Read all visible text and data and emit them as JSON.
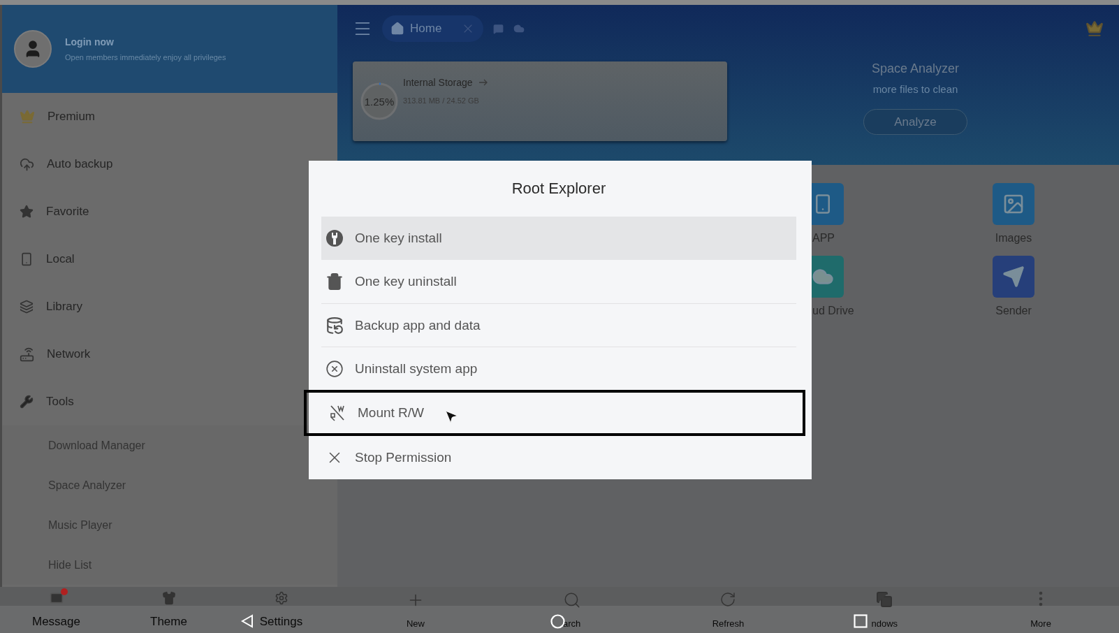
{
  "drawer": {
    "header": {
      "title": "Login now",
      "subtitle": "Open members immediately enjoy all privileges"
    },
    "items": [
      {
        "label": "Premium"
      },
      {
        "label": "Auto backup"
      },
      {
        "label": "Favorite"
      },
      {
        "label": "Local"
      },
      {
        "label": "Library"
      },
      {
        "label": "Network"
      },
      {
        "label": "Tools",
        "expanded": true,
        "children": [
          {
            "label": "Download Manager"
          },
          {
            "label": "Space Analyzer"
          },
          {
            "label": "Music Player"
          },
          {
            "label": "Hide List"
          }
        ]
      }
    ],
    "bottom_tabs": [
      {
        "label": "Message",
        "unread": true
      },
      {
        "label": "Theme",
        "unread": false
      },
      {
        "label": "Settings",
        "unread": false
      }
    ]
  },
  "top_bar": {
    "tab": {
      "label": "Home"
    }
  },
  "storage": {
    "title": "Internal Storage",
    "percent": "1.25%",
    "level": 0.0125,
    "usage": "313.81 MB / 24.52 GB"
  },
  "space_analyzer": {
    "title": "Space Analyzer",
    "subtitle": "more files to clean",
    "button": "Analyze"
  },
  "categories": [
    {
      "label": "APP",
      "color": "#1e5a86"
    },
    {
      "label": "Images",
      "color": "#1e5a86"
    },
    {
      "label": "ud Drive",
      "color": "#1f6b6b"
    },
    {
      "label": "Sender",
      "color": "#263f7a"
    }
  ],
  "toolbar": [
    {
      "label": "New"
    },
    {
      "label": "arch"
    },
    {
      "label": "Refresh"
    },
    {
      "label": "ndows"
    },
    {
      "label": "More"
    }
  ],
  "dialog": {
    "title": "Root Explorer",
    "items": [
      {
        "label": "One key install",
        "selected": true,
        "focused": false
      },
      {
        "label": "One key uninstall",
        "selected": false,
        "focused": false
      },
      {
        "label": "Backup app and data",
        "selected": false,
        "focused": false
      },
      {
        "label": "Uninstall system app",
        "selected": false,
        "focused": false
      },
      {
        "label": "Mount R/W",
        "selected": false,
        "focused": true
      },
      {
        "label": "Stop Permission",
        "selected": false,
        "focused": false
      }
    ]
  }
}
